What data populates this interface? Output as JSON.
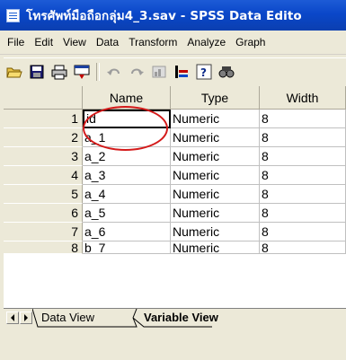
{
  "window": {
    "title": "โทรศัพท์มือถือกลุ่ม4_3.sav - SPSS Data Edito"
  },
  "menu": [
    "File",
    "Edit",
    "View",
    "Data",
    "Transform",
    "Analyze",
    "Graph"
  ],
  "toolbar_icons": [
    "open-folder-icon",
    "save-icon",
    "print-icon",
    "dialog-recall-icon",
    "undo-icon",
    "redo-icon",
    "goto-chart-icon",
    "goto-case-icon",
    "variables-info-icon",
    "find-icon"
  ],
  "grid": {
    "columns": [
      "Name",
      "Type",
      "Width"
    ],
    "rows": [
      {
        "num": "1",
        "name": "id",
        "type": "Numeric",
        "width": "8"
      },
      {
        "num": "2",
        "name": "a_1",
        "type": "Numeric",
        "width": "8"
      },
      {
        "num": "3",
        "name": "a_2",
        "type": "Numeric",
        "width": "8"
      },
      {
        "num": "4",
        "name": "a_3",
        "type": "Numeric",
        "width": "8"
      },
      {
        "num": "5",
        "name": "a_4",
        "type": "Numeric",
        "width": "8"
      },
      {
        "num": "6",
        "name": "a_5",
        "type": "Numeric",
        "width": "8"
      },
      {
        "num": "7",
        "name": "a_6",
        "type": "Numeric",
        "width": "8"
      },
      {
        "num": "8",
        "name": "b_7",
        "type": "Numeric",
        "width": "8"
      }
    ]
  },
  "tabs": {
    "data_view": "Data View",
    "variable_view": "Variable View"
  },
  "highlight_color": "#d41a1a"
}
